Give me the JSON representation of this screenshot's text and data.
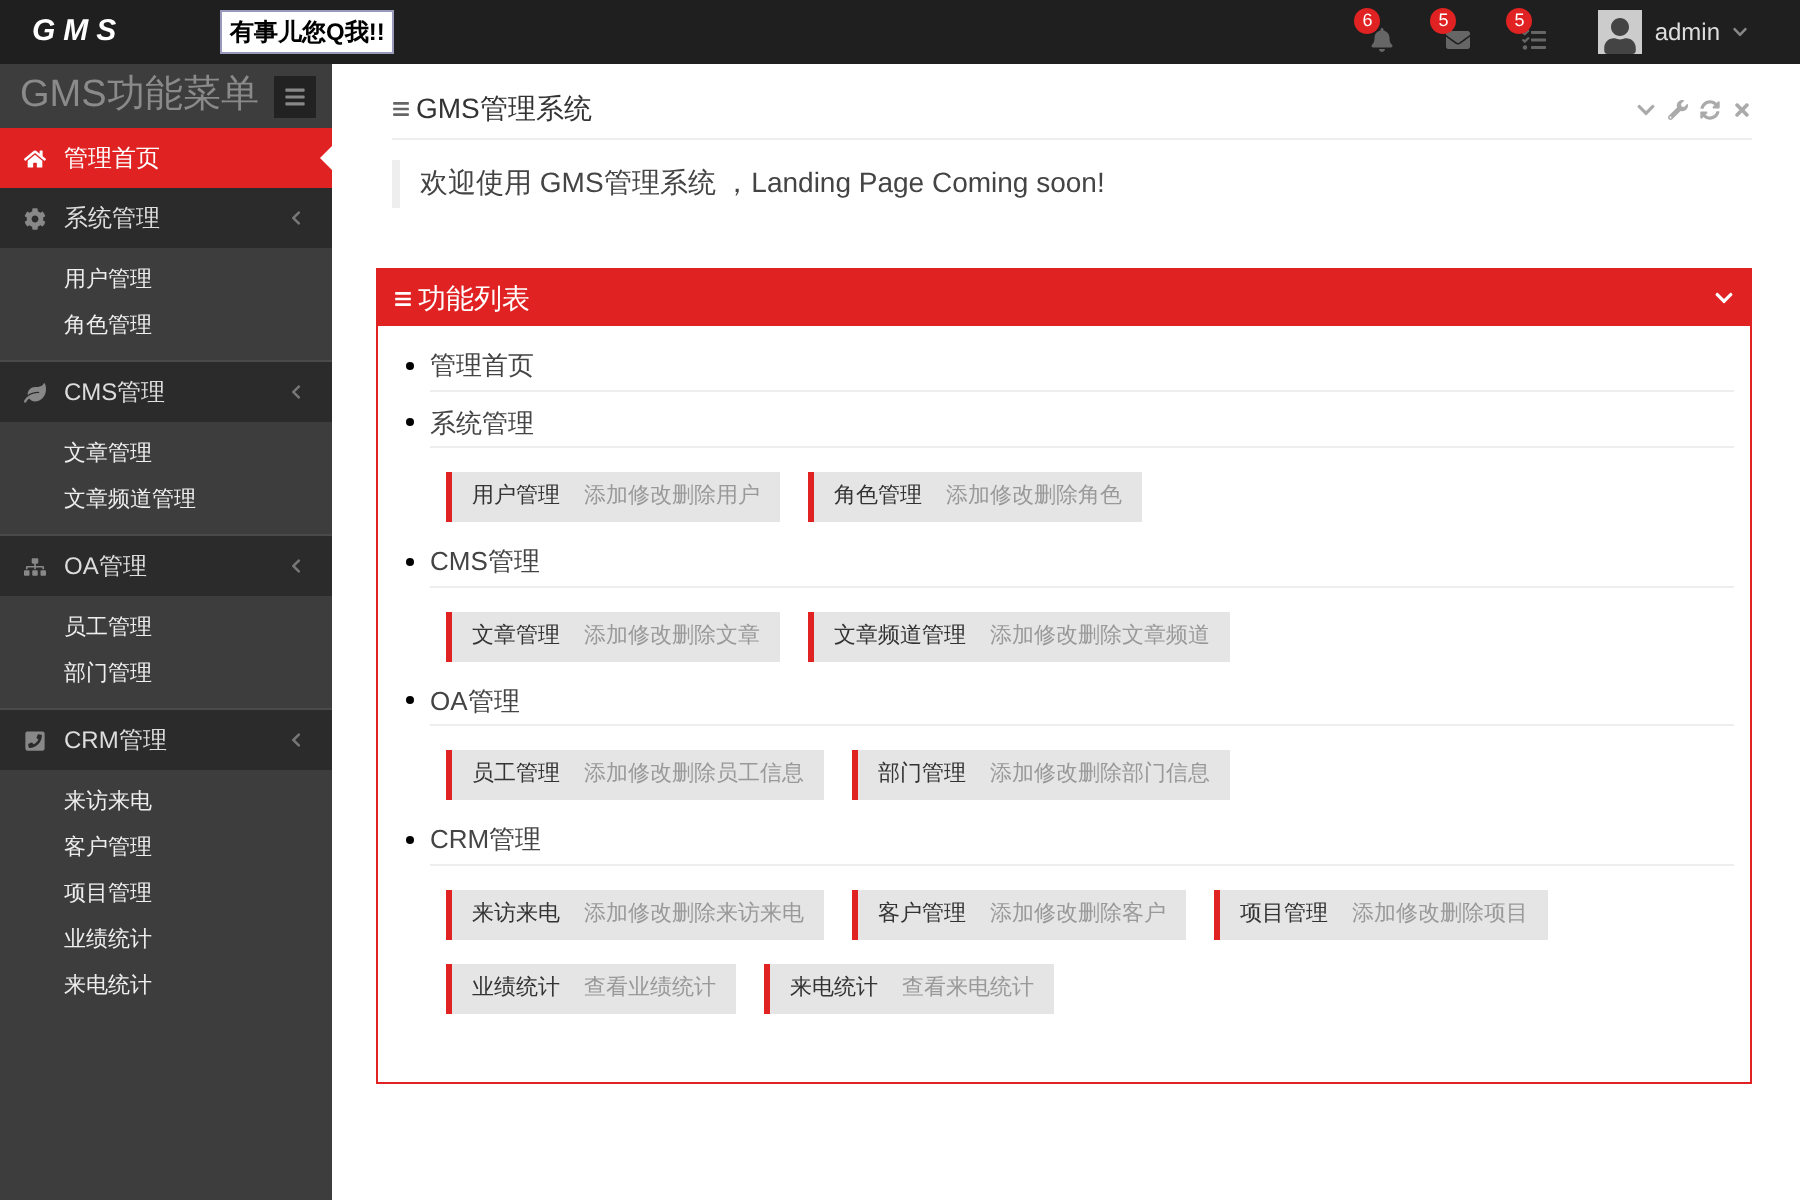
{
  "header": {
    "logo": "GMS",
    "qq_badge": "有事儿您Q我!!",
    "notifications": [
      {
        "kind": "alert",
        "count": "6"
      },
      {
        "kind": "mail",
        "count": "5"
      },
      {
        "kind": "tasks",
        "count": "5"
      }
    ],
    "user": "admin"
  },
  "sidebar": {
    "title": "GMS功能菜单",
    "items": [
      {
        "label": "管理首页",
        "kind": "home",
        "selected": true
      },
      {
        "label": "系统管理",
        "kind": "settings",
        "selected": false,
        "children": [
          {
            "label": "用户管理"
          },
          {
            "label": "角色管理"
          }
        ]
      },
      {
        "label": "CMS管理",
        "kind": "content",
        "selected": false,
        "children": [
          {
            "label": "文章管理"
          },
          {
            "label": "文章频道管理"
          }
        ]
      },
      {
        "label": "OA管理",
        "kind": "office",
        "selected": false,
        "children": [
          {
            "label": "员工管理"
          },
          {
            "label": "部门管理"
          }
        ]
      },
      {
        "label": "CRM管理",
        "kind": "crm",
        "selected": false,
        "children": [
          {
            "label": "来访来电"
          },
          {
            "label": "客户管理"
          },
          {
            "label": "项目管理"
          },
          {
            "label": "业绩统计"
          },
          {
            "label": "来电统计"
          }
        ]
      }
    ]
  },
  "welcome_panel": {
    "title": "GMS管理系统",
    "message": "欢迎使用 GMS管理系统 ，Landing Page Coming soon!"
  },
  "function_panel": {
    "title": "功能列表",
    "sections": [
      {
        "title": "管理首页"
      },
      {
        "title": "系统管理",
        "items": [
          {
            "name": "用户管理",
            "desc": "添加修改删除用户"
          },
          {
            "name": "角色管理",
            "desc": "添加修改删除角色"
          }
        ]
      },
      {
        "title": "CMS管理",
        "items": [
          {
            "name": "文章管理",
            "desc": "添加修改删除文章"
          },
          {
            "name": "文章频道管理",
            "desc": "添加修改删除文章频道"
          }
        ]
      },
      {
        "title": "OA管理",
        "items": [
          {
            "name": "员工管理",
            "desc": "添加修改删除员工信息"
          },
          {
            "name": "部门管理",
            "desc": "添加修改删除部门信息"
          }
        ]
      },
      {
        "title": "CRM管理",
        "items": [
          {
            "name": "来访来电",
            "desc": "添加修改删除来访来电"
          },
          {
            "name": "客户管理",
            "desc": "添加修改删除客户"
          },
          {
            "name": "项目管理",
            "desc": "添加修改删除项目"
          },
          {
            "name": "业绩统计",
            "desc": "查看业绩统计"
          },
          {
            "name": "来电统计",
            "desc": "查看来电统计"
          }
        ]
      }
    ]
  }
}
